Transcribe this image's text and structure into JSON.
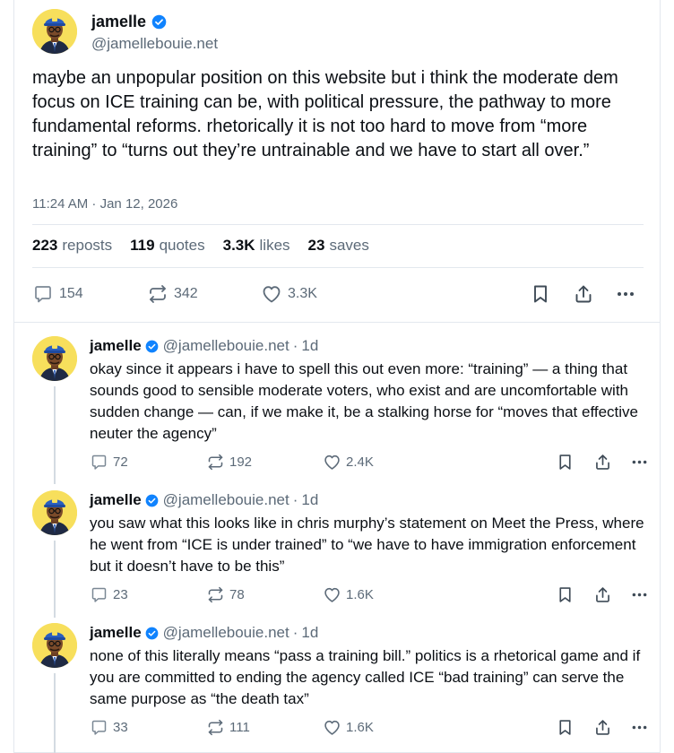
{
  "main_post": {
    "display_name": "jamelle",
    "handle": "@jamellebouie.net",
    "text": "maybe an unpopular position on this website but i think the moderate dem focus on ICE training can be, with political pressure, the pathway to more fundamental reforms. rhetorically it is not too hard to move from “more training” to “turns out they’re untrainable and we have to start all over.”",
    "timestamp": "11:24 AM · Jan 12, 2026",
    "stats": {
      "reposts_count": "223",
      "reposts_label": "reposts",
      "quotes_count": "119",
      "quotes_label": "quotes",
      "likes_count": "3.3K",
      "likes_label": "likes",
      "saves_count": "23",
      "saves_label": "saves"
    },
    "actions": {
      "replies": "154",
      "reposts": "342",
      "likes": "3.3K"
    }
  },
  "replies": [
    {
      "display_name": "jamelle",
      "handle": "@jamellebouie.net",
      "separator": "·",
      "time": "1d",
      "text": "okay since it appears i have to spell this out even more: “training” — a thing that sounds good to sensible moderate voters, who exist and are uncomfortable with sudden change — can, if we make it, be a stalking horse for “moves that effective neuter the agency”",
      "replies": "72",
      "reposts": "192",
      "likes": "2.4K"
    },
    {
      "display_name": "jamelle",
      "handle": "@jamellebouie.net",
      "separator": "·",
      "time": "1d",
      "text": "you saw what this looks like in chris murphy’s statement on Meet the Press, where he went from “ICE is under trained” to “we have to have immigration enforcement but it doesn’t have to be this”",
      "replies": "23",
      "reposts": "78",
      "likes": "1.6K"
    },
    {
      "display_name": "jamelle",
      "handle": "@jamellebouie.net",
      "separator": "·",
      "time": "1d",
      "text": "none of this literally means “pass a training bill.” politics is a rhetorical game and if you are committed to ending the agency called ICE “bad training” can serve the same purpose as “the death tax”",
      "replies": "33",
      "reposts": "111",
      "likes": "1.6K"
    }
  ],
  "colors": {
    "text": "#0b0f14",
    "muted": "#5c6a78",
    "verified": "#1083fe",
    "avatar_bg": "#f7df5c",
    "divider": "#e3e8ee"
  },
  "icons": [
    "verified-badge-icon",
    "reply-icon",
    "repost-icon",
    "like-icon",
    "bookmark-icon",
    "share-icon",
    "more-icon"
  ]
}
